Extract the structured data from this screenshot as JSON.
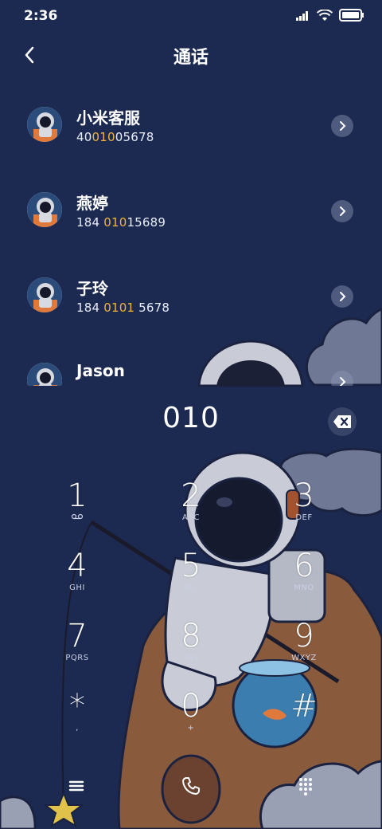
{
  "status_bar": {
    "time": "2:36"
  },
  "header": {
    "title": "通话"
  },
  "contacts": [
    {
      "name": "小米客服",
      "number_pre": "40",
      "number_match": "010",
      "number_post": "05678"
    },
    {
      "name": "燕婷",
      "number_pre": "184 ",
      "number_match": "010",
      "number_post": "15689"
    },
    {
      "name": "子玲",
      "number_pre": "184 ",
      "number_match": "0101",
      "number_post": " 5678"
    },
    {
      "name": "Jason",
      "number_pre": "",
      "number_match": "",
      "number_post": ""
    }
  ],
  "dialer": {
    "input": "010",
    "keys": [
      {
        "digit": "1",
        "letters": ""
      },
      {
        "digit": "2",
        "letters": "ABC"
      },
      {
        "digit": "3",
        "letters": "DEF"
      },
      {
        "digit": "4",
        "letters": "GHI"
      },
      {
        "digit": "5",
        "letters": "JKL"
      },
      {
        "digit": "6",
        "letters": "MNO"
      },
      {
        "digit": "7",
        "letters": "PQRS"
      },
      {
        "digit": "8",
        "letters": "TUV"
      },
      {
        "digit": "9",
        "letters": "WXYZ"
      },
      {
        "digit": "*",
        "letters": ","
      },
      {
        "digit": "0",
        "letters": "+"
      },
      {
        "digit": "#",
        "letters": ""
      }
    ]
  },
  "colors": {
    "background": "#1c2a52",
    "highlight": "#f0b43c",
    "text": "#ffffff"
  },
  "icons": {
    "back": "chevron-left-icon",
    "row_arrow": "chevron-right-icon",
    "backspace": "backspace-icon",
    "voicemail": "voicemail-icon",
    "menu": "menu-icon",
    "call": "phone-icon",
    "keypad": "keypad-icon"
  }
}
